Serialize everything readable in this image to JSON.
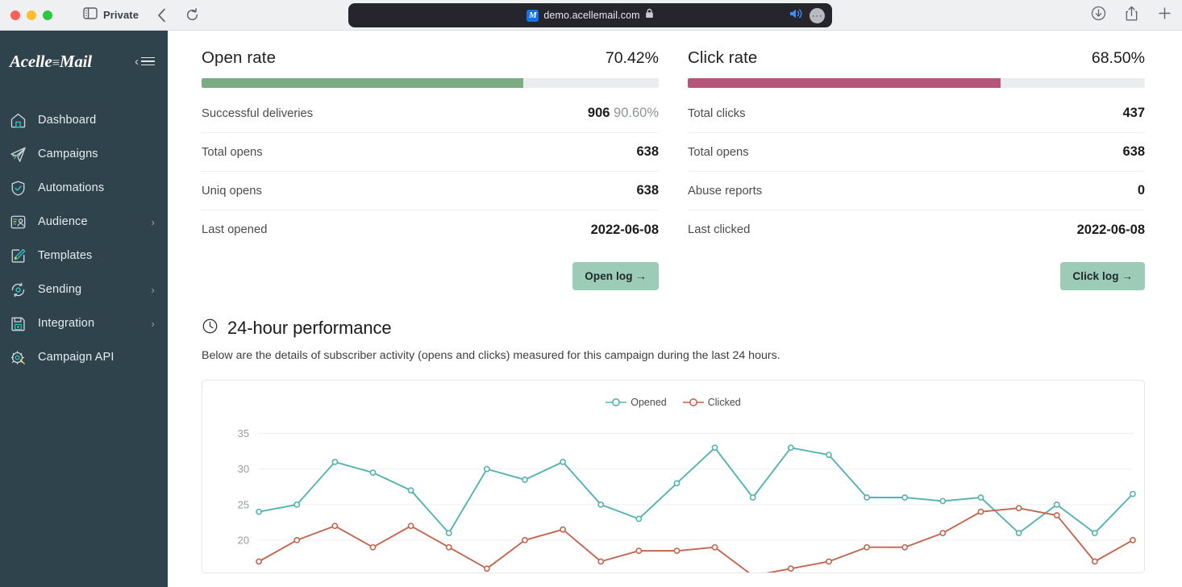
{
  "browser": {
    "tab_mode_label": "Private",
    "back_icon": "chevron-left-icon",
    "reload_icon": "reload-icon",
    "sidebar_toggle_icon": "sidebar-toggle-icon",
    "url": "demo.acellemail.com",
    "favicon_letter": "M",
    "lock_icon": "lock-icon",
    "audio_icon": "speaker-icon",
    "extensions_label": "···",
    "download_icon": "download-icon",
    "share_icon": "share-icon",
    "newtab_icon": "plus-icon"
  },
  "sidebar": {
    "brand": "Acelle",
    "brand_separator": "≡",
    "brand_suffix": "Mail",
    "collapse_label": "‹",
    "items": [
      {
        "label": "Dashboard",
        "icon": "home-icon",
        "chevron": ""
      },
      {
        "label": "Campaigns",
        "icon": "paper-plane-icon",
        "chevron": ""
      },
      {
        "label": "Automations",
        "icon": "shield-check-icon",
        "chevron": ""
      },
      {
        "label": "Audience",
        "icon": "audience-icon",
        "chevron": "›"
      },
      {
        "label": "Templates",
        "icon": "template-brush-icon",
        "chevron": ""
      },
      {
        "label": "Sending",
        "icon": "sync-icon",
        "chevron": "›"
      },
      {
        "label": "Integration",
        "icon": "integration-icon",
        "chevron": "›"
      },
      {
        "label": "Campaign API",
        "icon": "api-gear-icon",
        "chevron": ""
      }
    ]
  },
  "open_card": {
    "title": "Open rate",
    "percent": "70.42%",
    "bar_fill_percent": 70.42,
    "bar_color": "#7aab83",
    "rows": [
      {
        "key": "Successful deliveries",
        "value": "906",
        "muted": "90.60%"
      },
      {
        "key": "Total opens",
        "value": "638",
        "muted": ""
      },
      {
        "key": "Uniq opens",
        "value": "638",
        "muted": ""
      },
      {
        "key": "Last opened",
        "value": "2022-06-08",
        "muted": ""
      }
    ],
    "button_label": "Open log →"
  },
  "click_card": {
    "title": "Click rate",
    "percent": "68.50%",
    "bar_fill_percent": 68.5,
    "bar_color": "#b6577a",
    "rows": [
      {
        "key": "Total clicks",
        "value": "437",
        "muted": ""
      },
      {
        "key": "Total opens",
        "value": "638",
        "muted": ""
      },
      {
        "key": "Abuse reports",
        "value": "0",
        "muted": ""
      },
      {
        "key": "Last clicked",
        "value": "2022-06-08",
        "muted": ""
      }
    ],
    "button_label": "Click log →"
  },
  "performance": {
    "clock_icon": "clock-icon",
    "title": "24-hour performance",
    "subtitle": "Below are the details of subscriber activity (opens and clicks) measured for this campaign during the last 24 hours."
  },
  "chart_data": {
    "type": "line",
    "title": "",
    "xlabel": "",
    "ylabel": "",
    "ylim": [
      15,
      37
    ],
    "yticks": [
      20,
      25,
      30,
      35
    ],
    "grid": true,
    "legend_position": "top-center",
    "x": [
      0,
      1,
      2,
      3,
      4,
      5,
      6,
      7,
      8,
      9,
      10,
      11,
      12,
      13,
      14,
      15,
      16,
      17,
      18,
      19,
      20,
      21,
      22,
      23
    ],
    "series": [
      {
        "name": "Opened",
        "color": "#55b3b0",
        "values": [
          24,
          25,
          31,
          29.5,
          27,
          21,
          30,
          28.5,
          31,
          25,
          23,
          28,
          33,
          26,
          33,
          32,
          26,
          26,
          25.5,
          26,
          21,
          25,
          21,
          26.5
        ]
      },
      {
        "name": "Clicked",
        "color": "#c1674f",
        "values": [
          17,
          20,
          22,
          19,
          22,
          19,
          16,
          20,
          21.5,
          17,
          18.5,
          18.5,
          19,
          15,
          16,
          17,
          19,
          19,
          21,
          24,
          24.5,
          23.5,
          17,
          20
        ]
      }
    ]
  }
}
